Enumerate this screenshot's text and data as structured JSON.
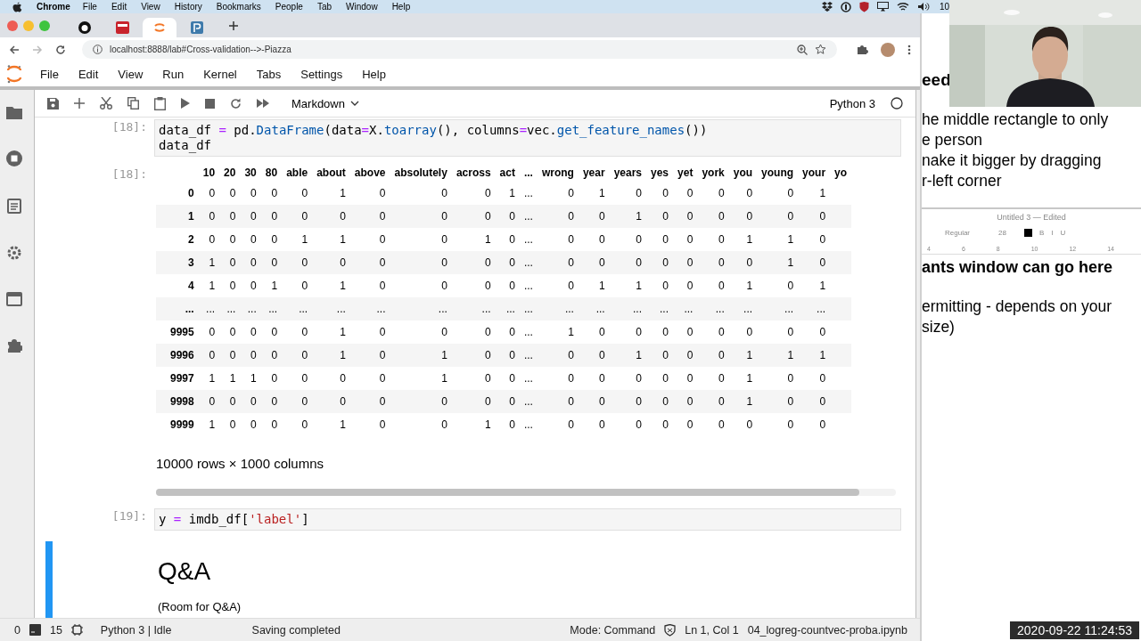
{
  "menu_bar": {
    "app": "Chrome",
    "items": [
      "File",
      "Edit",
      "View",
      "History",
      "Bookmarks",
      "People",
      "Tab",
      "Window",
      "Help"
    ],
    "battery": "10"
  },
  "browser": {
    "tabs": [
      {
        "kind": "github",
        "selected": false
      },
      {
        "kind": "red-logo",
        "selected": false
      },
      {
        "kind": "jupyter",
        "selected": true
      },
      {
        "kind": "p-logo",
        "selected": false
      }
    ],
    "url": "localhost:8888/lab#Cross-validation-->-Piazza"
  },
  "jupyter_menu": [
    "File",
    "Edit",
    "View",
    "Run",
    "Kernel",
    "Tabs",
    "Settings",
    "Help"
  ],
  "toolbar": {
    "cell_type": "Markdown",
    "kernel": "Python 3"
  },
  "cells": [
    {
      "kind": "code",
      "prompt": "[18]:",
      "lines": [
        [
          {
            "t": "data_df ",
            "kind": "n"
          },
          {
            "t": "=",
            "kind": "o"
          },
          {
            "t": " pd.",
            "kind": "n"
          },
          {
            "t": "DataFrame",
            "kind": "f"
          },
          {
            "t": "(data",
            "kind": "n"
          },
          {
            "t": "=",
            "kind": "o"
          },
          {
            "t": "X.",
            "kind": "n"
          },
          {
            "t": "toarray",
            "kind": "f"
          },
          {
            "t": "(), columns",
            "kind": "n"
          },
          {
            "t": "=",
            "kind": "o"
          },
          {
            "t": "vec.",
            "kind": "n"
          },
          {
            "t": "get_feature_names",
            "kind": "f"
          },
          {
            "t": "())",
            "kind": "n"
          }
        ],
        [
          {
            "t": "data_df",
            "kind": "n"
          }
        ]
      ],
      "output": {
        "prompt": "[18]:",
        "columns": [
          "10",
          "20",
          "30",
          "80",
          "able",
          "about",
          "above",
          "absolutely",
          "across",
          "act",
          "...",
          "wrong",
          "year",
          "years",
          "yes",
          "yet",
          "york",
          "you",
          "young",
          "your",
          "yo"
        ],
        "rows": [
          {
            "index": "0",
            "cells": [
              "0",
              "0",
              "0",
              "0",
              "0",
              "1",
              "0",
              "0",
              "0",
              "1",
              "...",
              "0",
              "1",
              "0",
              "0",
              "0",
              "0",
              "0",
              "0",
              "1"
            ]
          },
          {
            "index": "1",
            "cells": [
              "0",
              "0",
              "0",
              "0",
              "0",
              "0",
              "0",
              "0",
              "0",
              "0",
              "...",
              "0",
              "0",
              "1",
              "0",
              "0",
              "0",
              "0",
              "0",
              "0"
            ]
          },
          {
            "index": "2",
            "cells": [
              "0",
              "0",
              "0",
              "0",
              "1",
              "1",
              "0",
              "0",
              "1",
              "0",
              "...",
              "0",
              "0",
              "0",
              "0",
              "0",
              "0",
              "1",
              "1",
              "0"
            ]
          },
          {
            "index": "3",
            "cells": [
              "1",
              "0",
              "0",
              "0",
              "0",
              "0",
              "0",
              "0",
              "0",
              "0",
              "...",
              "0",
              "0",
              "0",
              "0",
              "0",
              "0",
              "0",
              "1",
              "0"
            ]
          },
          {
            "index": "4",
            "cells": [
              "1",
              "0",
              "0",
              "1",
              "0",
              "1",
              "0",
              "0",
              "0",
              "0",
              "...",
              "0",
              "1",
              "1",
              "0",
              "0",
              "0",
              "1",
              "0",
              "1"
            ]
          },
          {
            "index": "...",
            "cells": [
              "...",
              "...",
              "...",
              "...",
              "...",
              "...",
              "...",
              "...",
              "...",
              "...",
              "...",
              "...",
              "...",
              "...",
              "...",
              "...",
              "...",
              "...",
              "...",
              "..."
            ]
          },
          {
            "index": "9995",
            "cells": [
              "0",
              "0",
              "0",
              "0",
              "0",
              "1",
              "0",
              "0",
              "0",
              "0",
              "...",
              "1",
              "0",
              "0",
              "0",
              "0",
              "0",
              "0",
              "0",
              "0"
            ]
          },
          {
            "index": "9996",
            "cells": [
              "0",
              "0",
              "0",
              "0",
              "0",
              "1",
              "0",
              "1",
              "0",
              "0",
              "...",
              "0",
              "0",
              "1",
              "0",
              "0",
              "0",
              "1",
              "1",
              "1"
            ]
          },
          {
            "index": "9997",
            "cells": [
              "1",
              "1",
              "1",
              "0",
              "0",
              "0",
              "0",
              "1",
              "0",
              "0",
              "...",
              "0",
              "0",
              "0",
              "0",
              "0",
              "0",
              "1",
              "0",
              "0"
            ]
          },
          {
            "index": "9998",
            "cells": [
              "0",
              "0",
              "0",
              "0",
              "0",
              "0",
              "0",
              "0",
              "0",
              "0",
              "...",
              "0",
              "0",
              "0",
              "0",
              "0",
              "0",
              "1",
              "0",
              "0"
            ]
          },
          {
            "index": "9999",
            "cells": [
              "1",
              "0",
              "0",
              "0",
              "0",
              "1",
              "0",
              "0",
              "1",
              "0",
              "...",
              "0",
              "0",
              "0",
              "0",
              "0",
              "0",
              "0",
              "0",
              "0"
            ]
          }
        ],
        "summary": "10000 rows × 1000 columns"
      }
    },
    {
      "kind": "code",
      "prompt": "[19]:",
      "lines": [
        [
          {
            "t": "y ",
            "kind": "n"
          },
          {
            "t": "=",
            "kind": "o"
          },
          {
            "t": " imdb_df[",
            "kind": "n"
          },
          {
            "t": "'label'",
            "kind": "s"
          },
          {
            "t": "]",
            "kind": "n"
          }
        ]
      ]
    },
    {
      "kind": "markdown",
      "selected": true,
      "heading": "Q&A",
      "text": "(Room for Q&A)"
    }
  ],
  "status_bar": {
    "count_a": "0",
    "count_b": "15",
    "kernel": "Python 3 | Idle",
    "message": "Saving completed",
    "mode": "Mode: Command",
    "position": "Ln 1, Col 1",
    "file": "04_logreg-countvec-proba.ipynb"
  },
  "side_window": {
    "heading": "eed",
    "lines": [
      "he middle rectangle to only",
      "e person",
      "nake it bigger by dragging",
      "r-left corner"
    ],
    "editor": {
      "title": "Untitled 3 — Edited",
      "font_style": "Regular",
      "font_size": "28",
      "buttons": [
        "B",
        "I",
        "U"
      ],
      "ruler": [
        "4",
        "6",
        "8",
        "10",
        "12",
        "14"
      ]
    },
    "bold_line": "ants window can go here",
    "body": [
      "ermitting - depends on your",
      "size)"
    ]
  },
  "timestamp": "2020-09-22 11:24:53"
}
